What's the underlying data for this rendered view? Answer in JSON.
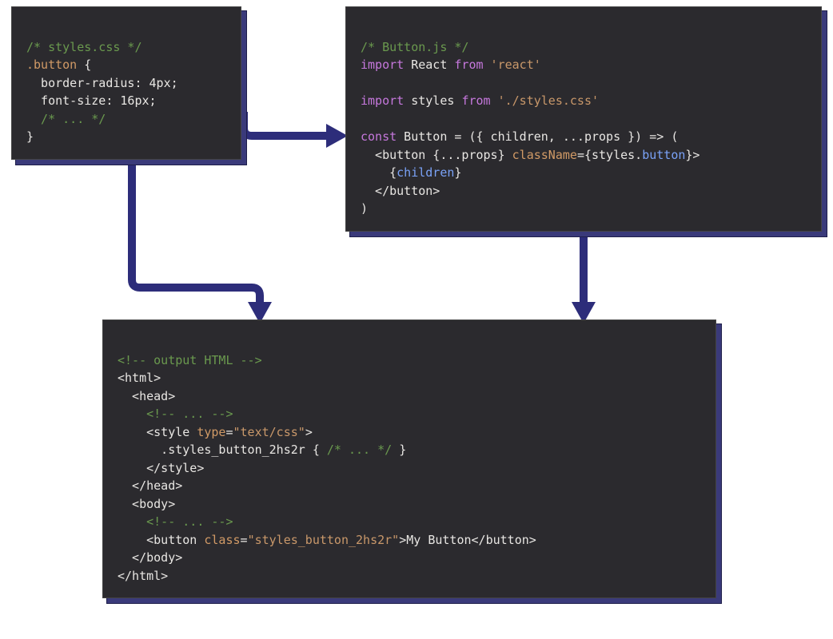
{
  "css_box": {
    "line1": "/* styles.css */",
    "line2_a": ".button",
    "line2_b": " {",
    "line3": "  border-radius: 4px;",
    "line4": "  font-size: 16px;",
    "line5": "  /* ... */",
    "line6": "}"
  },
  "js_box": {
    "l1": "/* Button.js */",
    "l2_import": "import",
    "l2_react": " React ",
    "l2_from": "from",
    "l2_str": " 'react'",
    "l3": "",
    "l4_import": "import",
    "l4_styles": " styles ",
    "l4_from": "from",
    "l4_str": " './styles.css'",
    "l5": "",
    "l6_const": "const",
    "l6_rest": " Button = ({ children, ...props }) => (",
    "l7_a": "  <button {...props} ",
    "l7_attr": "className",
    "l7_eq": "=",
    "l7_b": "{styles.",
    "l7_prop": "button",
    "l7_c": "}>",
    "l8_a": "    {",
    "l8_b": "children",
    "l8_c": "}",
    "l9": "  </button>",
    "l10": ")"
  },
  "html_box": {
    "l1": "<!-- output HTML -->",
    "l2": "<html>",
    "l3": "  <head>",
    "l4": "    <!-- ... -->",
    "l5_a": "    <style ",
    "l5_attr": "type",
    "l5_eq": "=",
    "l5_str": "\"text/css\"",
    "l5_c": ">",
    "l6_a": "      .styles_button_2hs2r { ",
    "l6_cm": "/* ... */",
    "l6_b": " }",
    "l7": "    </style>",
    "l8": "  </head>",
    "l9": "  <body>",
    "l10": "    <!-- ... -->",
    "l11_a": "    <button ",
    "l11_attr": "class",
    "l11_eq": "=",
    "l11_str": "\"styles_button_2hs2r\"",
    "l11_b": ">My Button</button>",
    "l12": "  </body>",
    "l13": "</html>"
  }
}
